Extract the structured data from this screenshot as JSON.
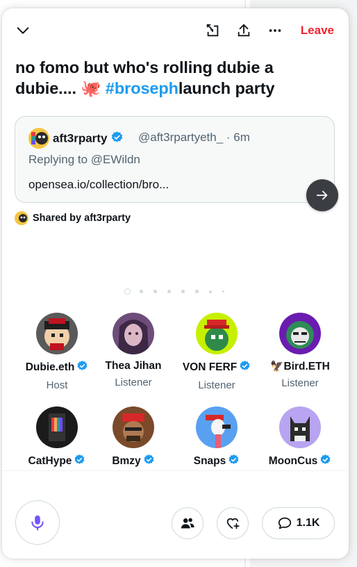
{
  "space": {
    "title_part1": "no fomo but who's rolling dubie a dubie.... ",
    "title_emoji": "🐙",
    "title_space": " ",
    "title_hashtag": "#broseph",
    "title_tail": "launch party",
    "leave_label": "Leave"
  },
  "tweet": {
    "name": "aft3rparty",
    "handle": "@aft3rpartyeth_ · 6m",
    "reply": "Replying to @EWildn",
    "link": "opensea.io/collection/bro..."
  },
  "shared_by": "Shared by aft3rparty",
  "speakers": [
    {
      "name": "Dubie.eth",
      "role": "Host",
      "verified": true
    },
    {
      "name": "Thea Jihan",
      "role": "Listener",
      "verified": false
    },
    {
      "name": "VON FERF",
      "role": "Listener",
      "verified": true
    },
    {
      "name": "🦅Bird.ETH",
      "role": "Listener",
      "verified": false
    },
    {
      "name": "CatHype",
      "role": "",
      "verified": true
    },
    {
      "name": "Bmzy",
      "role": "",
      "verified": true
    },
    {
      "name": "Snaps",
      "role": "",
      "verified": true
    },
    {
      "name": "MoonCus",
      "role": "",
      "verified": true
    }
  ],
  "bottom": {
    "reply_count": "1.1K"
  },
  "colors": {
    "accent": "#1d9bf0",
    "leave": "#f4212e",
    "mic": "#7856ff"
  },
  "icons": [
    "chevron-down-icon",
    "minimize-icon",
    "share-icon",
    "more-icon",
    "verified-icon",
    "arrow-right-icon",
    "microphone-icon",
    "people-icon",
    "heart-plus-icon",
    "comment-icon"
  ]
}
